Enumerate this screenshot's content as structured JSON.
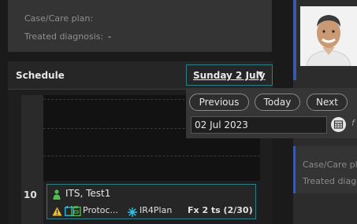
{
  "patient_info_left": {
    "case_label": "Case/Care plan:",
    "diagnosis_label": "Treated diagnosis:",
    "diagnosis_value": "-"
  },
  "schedule": {
    "title": "Schedule",
    "date_label": "Sunday 2 July",
    "slot_number": "10",
    "appointment": {
      "name": "ITS, Test1",
      "protocol": "Protoc...",
      "plan": "IR4Plan",
      "fractions": "Fx 2 ts (2/30)"
    }
  },
  "date_popup": {
    "previous": "Previous",
    "today": "Today",
    "next": "Next",
    "date_value": "02 Jul 2023",
    "trailing_fragment": "f"
  },
  "right_info": {
    "case_label": "Case/Care pla",
    "diagnosis_label": "Treated diagn"
  },
  "colors": {
    "accent_teal": "#2f7f8a",
    "accent_blue": "#3a5aa8",
    "person_green": "#4fc04f",
    "warning_yellow": "#f0c020",
    "plan_cyan": "#2ec4e6"
  },
  "icons": [
    "person-icon",
    "warning-icon",
    "calendar-icon",
    "protocol-icon",
    "star-icon",
    "chevron-down-icon"
  ]
}
